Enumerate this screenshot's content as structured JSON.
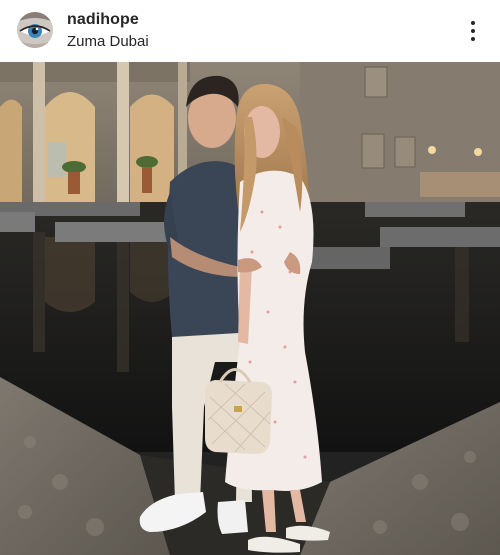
{
  "post": {
    "username": "nadihope",
    "location": "Zuma Dubai",
    "avatar_icon": "eye-avatar-icon",
    "more_icon": "more-options-icon"
  },
  "photo": {
    "description_icon": "couple-photo"
  },
  "colors": {
    "text": "#262626",
    "background": "#ffffff"
  }
}
